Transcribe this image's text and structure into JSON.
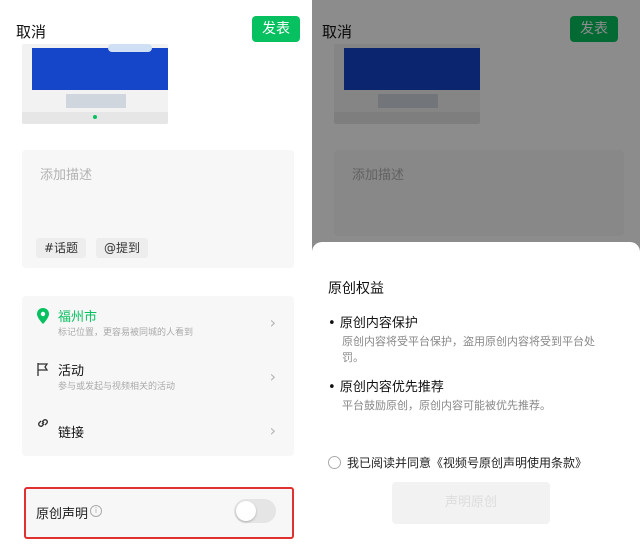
{
  "left": {
    "cancel_label": "取消",
    "publish_label": "发表",
    "description_placeholder": "添加描述",
    "tags": [
      "#话题",
      "@提到"
    ],
    "location": {
      "title": "福州市",
      "subtitle": "标记位置，更容易被同城的人看到",
      "icon": "location-pin-icon"
    },
    "activity": {
      "title": "活动",
      "subtitle": "参与或发起与视频相关的活动",
      "icon": "flag-icon"
    },
    "link": {
      "title": "链接",
      "icon": "link-icon"
    },
    "original_label": "原创声明",
    "original_toggle_on": false
  },
  "right": {
    "cancel_label": "取消",
    "publish_label": "发表",
    "description_placeholder": "添加描述",
    "sheet_title": "原创权益",
    "benefits": [
      {
        "heading": "原创内容保护",
        "text": "原创内容将受平台保护，盗用原创内容将受到平台处罚。"
      },
      {
        "heading": "原创内容优先推荐",
        "text": "平台鼓励原创，原创内容可能被优先推荐。"
      }
    ],
    "agree_text": "我已阅读并同意《视频号原创声明使用条款》",
    "confirm_label": "声明原创"
  },
  "colors": {
    "accent": "#07c160",
    "highlight_border": "#e03030"
  }
}
